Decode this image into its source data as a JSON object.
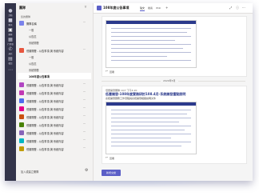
{
  "panel": {
    "title": "團隊",
    "section_label": "您的團隊",
    "teams": [
      {
        "label": "團隊名稱",
        "color": "#7b83eb"
      },
      {
        "label": "低層開發 - 公告事項 與 系統內容",
        "color": "#e8563f"
      },
      {
        "label": "低層開發 - 公告事項 與 系統內容",
        "color": "#b146c2"
      },
      {
        "label": "低層開發 - 公告事項 與 系統內容",
        "color": "#c239b3"
      },
      {
        "label": "低層開發 - 公告事項 與 系統內容",
        "color": "#4f6bed"
      },
      {
        "label": "低層開發 - 公告事項 與 系統內容",
        "color": "#e3008c"
      },
      {
        "label": "低層開發 - 公告事項 與 系統內容",
        "color": "#ca5010"
      },
      {
        "label": "低層開發 - 公告事項 與 系統內容",
        "color": "#498205"
      },
      {
        "label": "低層開發 - 公告事項 與 系統內容",
        "color": "#8764b8"
      },
      {
        "label": "低層開發 - 公告事項 與 系統內容",
        "color": "#00b7c3"
      },
      {
        "label": "低層開發 - 公告事項 與 系統內容",
        "color": "#c19c00"
      }
    ],
    "channels": [
      "一般",
      "公告區",
      "系統開發",
      "108年度公告事項"
    ],
    "footer": {
      "join": "加入或建立團隊"
    }
  },
  "rail": {
    "items": [
      {
        "label": "活動",
        "icon": "bell-icon"
      },
      {
        "label": "聊天",
        "icon": "chat-icon"
      },
      {
        "label": "團隊",
        "icon": "teams-icon"
      },
      {
        "label": "行事曆",
        "icon": "calendar-icon"
      },
      {
        "label": "通話",
        "icon": "phone-icon"
      },
      {
        "label": "檔案",
        "icon": "file-icon"
      }
    ]
  },
  "channel": {
    "title": "108年度公告事項",
    "tabs": [
      "貼文",
      "檔案",
      "Wiki"
    ]
  },
  "posts": [
    {
      "reply": "回覆"
    },
    {
      "author": "低層開發團隊  10/7 下午4:20",
      "title": "低層開發-108年度實務研討108.4月-系統開發重點說明",
      "subtitle": "系統開發實務工作流程與系統開發相關說明文件",
      "reply": "回覆"
    }
  ],
  "divider_date": "2020年5月",
  "new_post": "新增交談"
}
